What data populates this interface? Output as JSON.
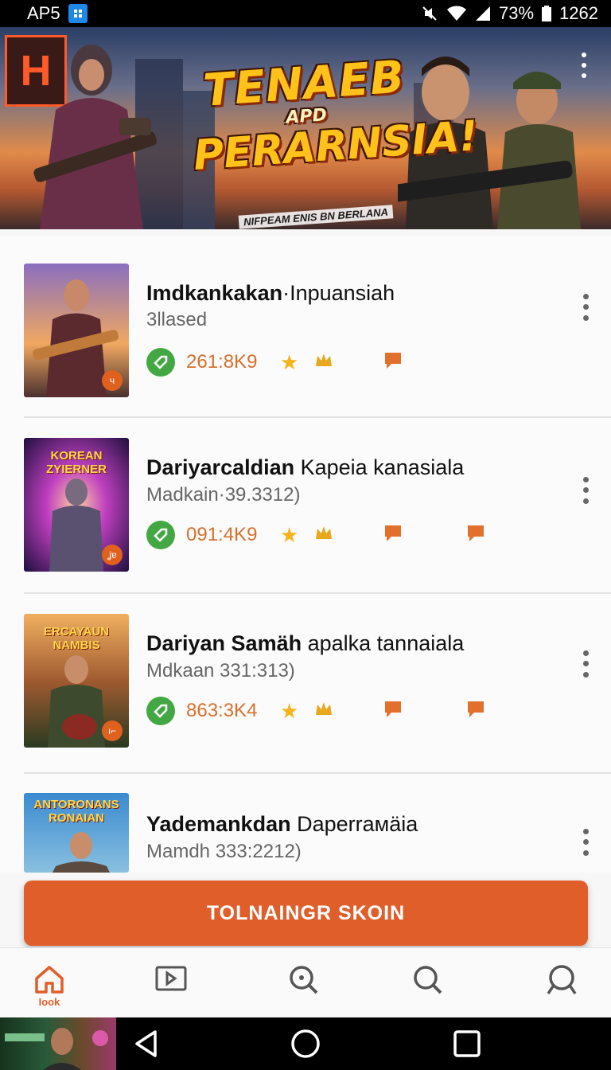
{
  "status_bar": {
    "carrier": "AP5",
    "battery_percent": "73%",
    "time": "1262",
    "icons": [
      "app-notification-icon",
      "mute-icon",
      "wifi-icon",
      "signal-icon",
      "battery-icon"
    ]
  },
  "banner": {
    "title_line1": "TENAEB",
    "title_line2": "APD",
    "title_line3": "PERARNSIA!",
    "subtitle": "NIFPEAM ENIS BN BERLANA",
    "neon_sign": "H",
    "menu_icon": "more-vertical-icon"
  },
  "list": {
    "items": [
      {
        "title_bold": "Imdkankakan",
        "title_rest": "·Inpuansiah",
        "subtitle": "3llased",
        "stat": "261:8K9",
        "thumb_caption": "",
        "thumb_badge": "ч",
        "icons": [
          "tag-icon",
          "star-icon",
          "crown-icon",
          "chat-icon"
        ]
      },
      {
        "title_bold": "Dariyarcaldian",
        "title_rest": " Kapeia kanasiala",
        "subtitle": "Madkain·39.3312)",
        "stat": "091:4K9",
        "thumb_caption": "KOREAN ZYIERNER",
        "thumb_badge": "ʝɐ",
        "icons": [
          "tag-icon",
          "star-icon",
          "crown-icon",
          "chat-icon",
          "chat-icon"
        ]
      },
      {
        "title_bold": "Dariyan Samäh",
        "title_rest": " apalka tannaiala",
        "subtitle": "Mdkaan 331:313)",
        "stat": "863:3K4",
        "thumb_caption": "ERCAYAUN NAMBIS",
        "thumb_badge": "ı⌐",
        "icons": [
          "tag-icon",
          "star-icon",
          "crown-icon",
          "chat-icon",
          "chat-icon"
        ]
      },
      {
        "title_bold": "Yademankdan",
        "title_rest": " Daperrамäia",
        "subtitle": "Mamdh 333:2212)",
        "stat": "",
        "thumb_caption": "ANTORONANS RONAIAN",
        "thumb_badge": "",
        "icons": []
      }
    ]
  },
  "cta": {
    "label": "TOLNAINGR SKOIN"
  },
  "bottom_nav": {
    "items": [
      {
        "icon": "home-icon",
        "label": "Iook",
        "active": true
      },
      {
        "icon": "play-icon",
        "label": ""
      },
      {
        "icon": "search-icon",
        "label": ""
      },
      {
        "icon": "search-icon",
        "label": ""
      },
      {
        "icon": "profile-search-icon",
        "label": ""
      }
    ]
  },
  "system_nav": {
    "icons": [
      "back-icon",
      "home-circle-icon",
      "recents-icon"
    ]
  },
  "colors": {
    "accent": "#e05e2a",
    "green": "#43a843",
    "stat_text": "#d8702c",
    "star": "#f4b41a"
  }
}
